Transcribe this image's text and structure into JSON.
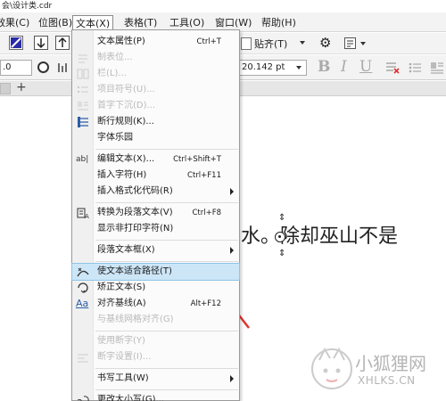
{
  "window": {
    "title": "会\\设计类.cdr"
  },
  "menubar": {
    "items": [
      "效果(C)",
      "位图(B)",
      "文本(X)",
      "表格(T)",
      "工具(O)",
      "窗口(W)",
      "帮助(H)"
    ]
  },
  "toolbar1": {
    "align_label": "贴齐(T)"
  },
  "toolbar2": {
    "pos_value": ".0",
    "font_size": "20.142 pt"
  },
  "text_menu": {
    "items": [
      {
        "label": "文本属性(P)",
        "shortcut": "Ctrl+T"
      },
      {
        "label": "制表位...",
        "shortcut": ""
      },
      {
        "label": "栏(L)...",
        "shortcut": ""
      },
      {
        "label": "项目符号(U)...",
        "shortcut": ""
      },
      {
        "label": "首字下沉(D)...",
        "shortcut": ""
      },
      {
        "label": "断行规则(K)...",
        "shortcut": ""
      },
      {
        "label": "字体乐园",
        "shortcut": ""
      },
      {
        "label": "编辑文本(X)...",
        "shortcut": "Ctrl+Shift+T"
      },
      {
        "label": "插入字符(H)",
        "shortcut": "Ctrl+F11"
      },
      {
        "label": "插入格式化代码(R)",
        "shortcut": ""
      },
      {
        "label": "转换为段落文本(V)",
        "shortcut": "Ctrl+F8"
      },
      {
        "label": "显示非打印字符(N)",
        "shortcut": ""
      },
      {
        "label": "段落文本框(X)",
        "shortcut": ""
      },
      {
        "label": "使文本适合路径(T)",
        "shortcut": ""
      },
      {
        "label": "矫正文本(S)",
        "shortcut": ""
      },
      {
        "label": "对齐基线(A)",
        "shortcut": "Alt+F12"
      },
      {
        "label": "与基线网格对齐(G)",
        "shortcut": ""
      },
      {
        "label": "使用断字(Y)",
        "shortcut": ""
      },
      {
        "label": "断字设置(I)...",
        "shortcut": ""
      },
      {
        "label": "书写工具(W)",
        "shortcut": ""
      },
      {
        "label": "更改大小写(G)...",
        "shortcut": ""
      }
    ]
  },
  "canvas": {
    "text": "水。除却巫山不是"
  },
  "watermark": {
    "cn": "小狐狸网",
    "en": "XHLKS.CN"
  },
  "colors": {
    "highlight": "#cde6f7",
    "arrow": "#e0352f"
  }
}
